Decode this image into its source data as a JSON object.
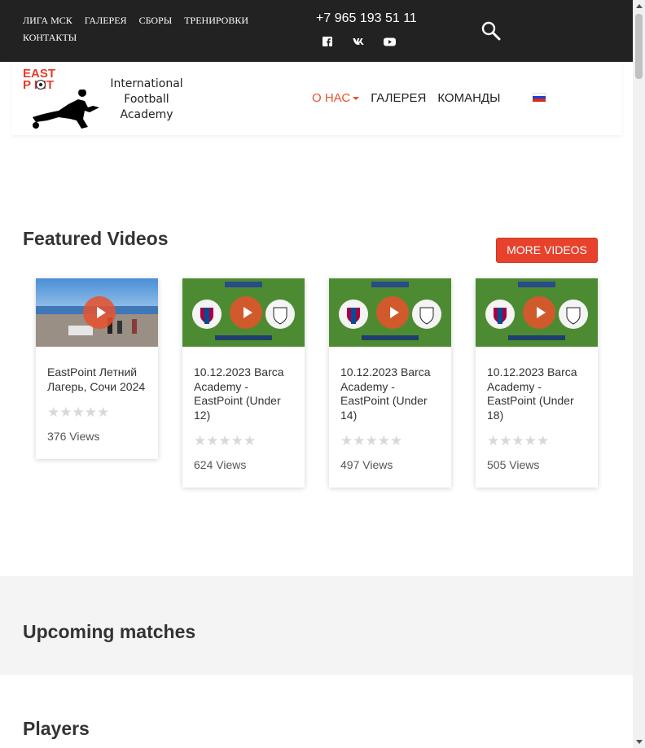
{
  "topbar": {
    "nav": [
      "ЛИГА МСК",
      "ГАЛЕРЕЯ",
      "СБОРЫ",
      "ТРЕНИРОВКИ",
      "КОНТАКТЫ"
    ],
    "phone": "+7 965 193 51 11",
    "socials": [
      "facebook-icon",
      "vk-icon",
      "youtube-icon"
    ]
  },
  "logo": {
    "east": "EAST",
    "point": "P   INT",
    "line1": "International",
    "line2": "Football",
    "line3": "Academy"
  },
  "mainnav": {
    "about": "О НАС",
    "gallery": "ГАЛЕРЕЯ",
    "teams": "КОМАНДЫ",
    "language": "ru"
  },
  "featured": {
    "title": "Featured Videos",
    "more_label": "MORE VIDEOS",
    "videos": [
      {
        "title": "EastPoint Летний Лагерь, Сочи 2024",
        "views": "376 Views",
        "rating": 0
      },
      {
        "title": "10.12.2023 Barca Academy - EastPoint (Under 12)",
        "views": "624 Views",
        "rating": 0
      },
      {
        "title": "10.12.2023 Barca Academy - EastPoint (Under 14)",
        "views": "497 Views",
        "rating": 0
      },
      {
        "title": "10.12.2023 Barca Academy - EastPoint (Under 18)",
        "views": "505 Views",
        "rating": 0
      }
    ],
    "stars": "★★★★★"
  },
  "upcoming": {
    "title": "Upcoming matches"
  },
  "players": {
    "title": "Players"
  },
  "colors": {
    "accent": "#e8512c",
    "topbar": "#222222",
    "upcoming_bg": "#f4f4f4"
  }
}
